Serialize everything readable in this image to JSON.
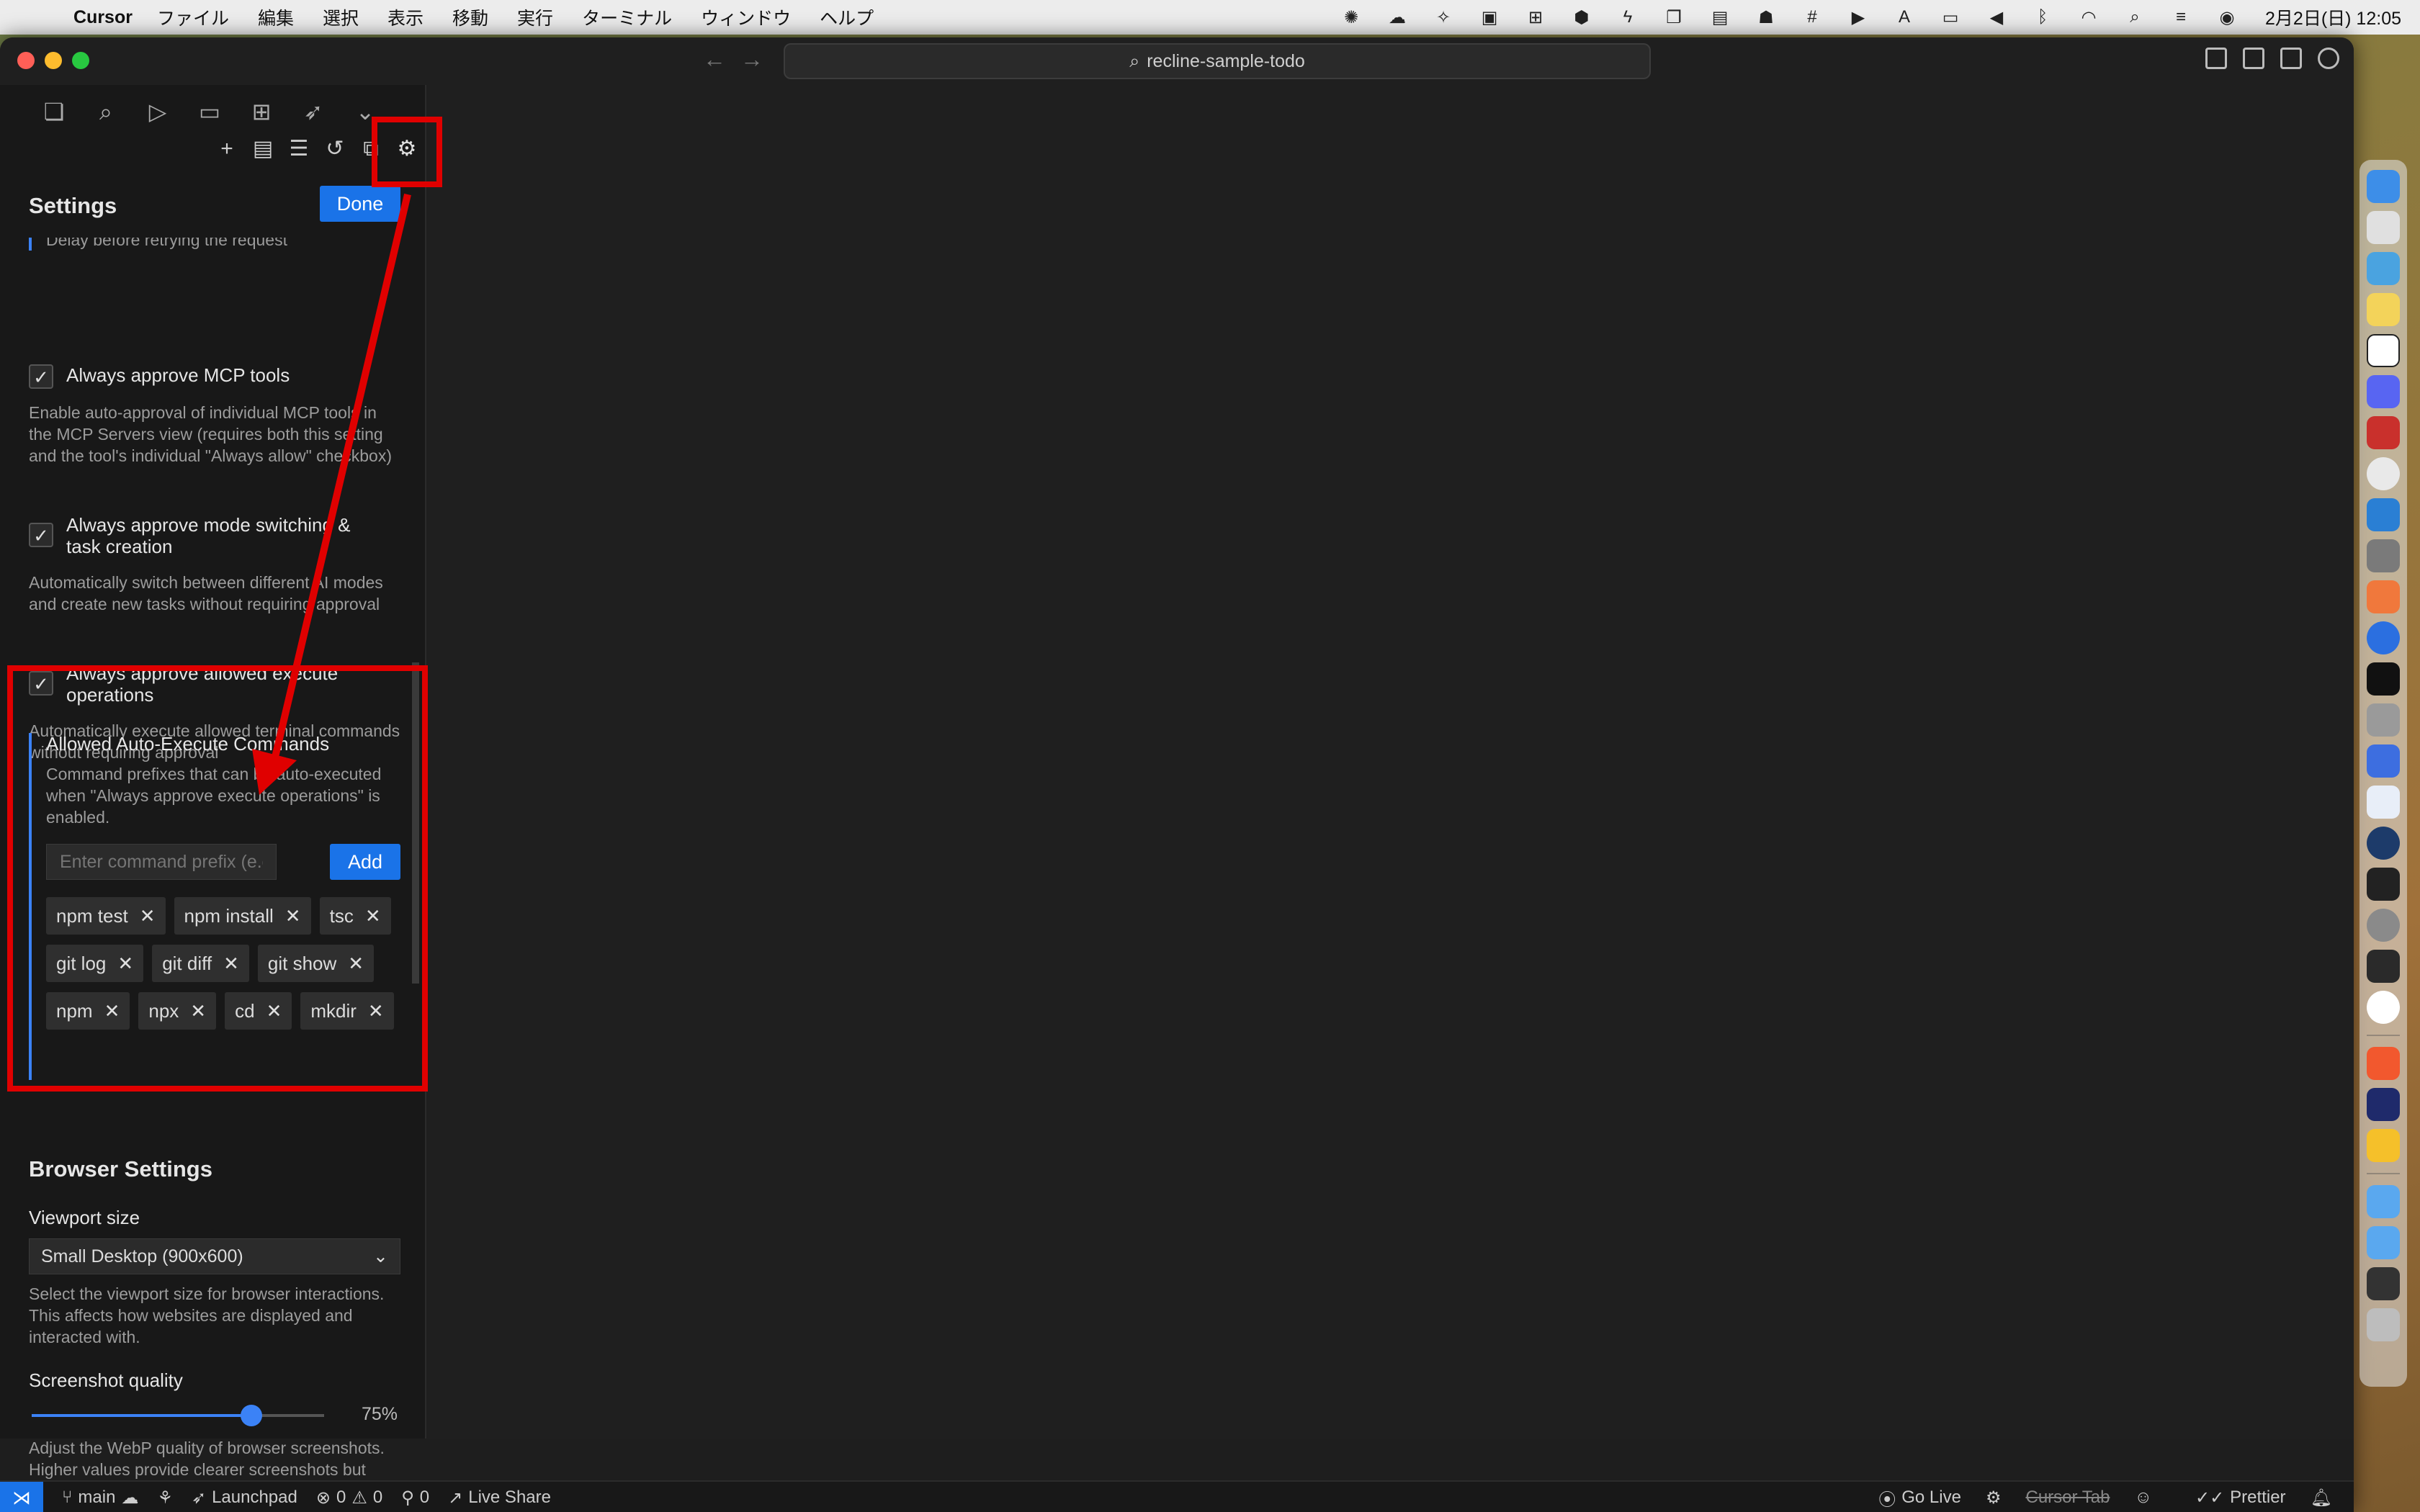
{
  "menubar": {
    "app_name": "Cursor",
    "items": [
      "ファイル",
      "編集",
      "選択",
      "表示",
      "移動",
      "実行",
      "ターミナル",
      "ウィンドウ",
      "ヘルプ"
    ],
    "clock": "2月2日(日)  12:05"
  },
  "titlebar": {
    "search_text": "recline-sample-todo"
  },
  "sidebar": {
    "settings_title": "Settings",
    "done_label": "Done",
    "cut_off_text": "Delay before retrying the request",
    "checks": [
      {
        "label": "Always approve MCP tools",
        "desc": "Enable auto-approval of individual MCP tools in the MCP Servers view (requires both this setting and the tool's individual \"Always allow\" checkbox)"
      },
      {
        "label": "Always approve mode switching & task creation",
        "desc": "Automatically switch between different AI modes and create new tasks without requiring approval"
      },
      {
        "label": "Always approve allowed execute operations",
        "desc": "Automatically execute allowed terminal commands without requiring approval"
      }
    ],
    "allowed": {
      "title": "Allowed Auto-Execute Commands",
      "desc": "Command prefixes that can be auto-executed when \"Always approve execute operations\" is enabled.",
      "input_placeholder": "Enter command prefix (e.g.,",
      "add_label": "Add",
      "commands": [
        "npm test",
        "npm install",
        "tsc",
        "git log",
        "git diff",
        "git show",
        "npm",
        "npx",
        "cd",
        "mkdir"
      ]
    },
    "browser": {
      "title": "Browser Settings",
      "viewport_label": "Viewport size",
      "viewport_value": "Small Desktop (900x600)",
      "viewport_desc": "Select the viewport size for browser interactions. This affects how websites are displayed and interacted with.",
      "quality_label": "Screenshot quality",
      "quality_value": "75%",
      "quality_fraction": 0.75,
      "quality_desc": "Adjust the WebP quality of browser screenshots. Higher values provide clearer screenshots but increase token usage."
    }
  },
  "statusbar": {
    "branch": "main",
    "launchpad": "Launchpad",
    "errors": "0",
    "warnings": "0",
    "ports": "0",
    "live_share": "Live Share",
    "go_live": "Go Live",
    "cursor_tab": "Cursor Tab",
    "prettier": "Prettier"
  },
  "colors": {
    "accent": "#1a73e8",
    "annotation": "#e00000",
    "editor_bg": "#1f1f1f"
  }
}
